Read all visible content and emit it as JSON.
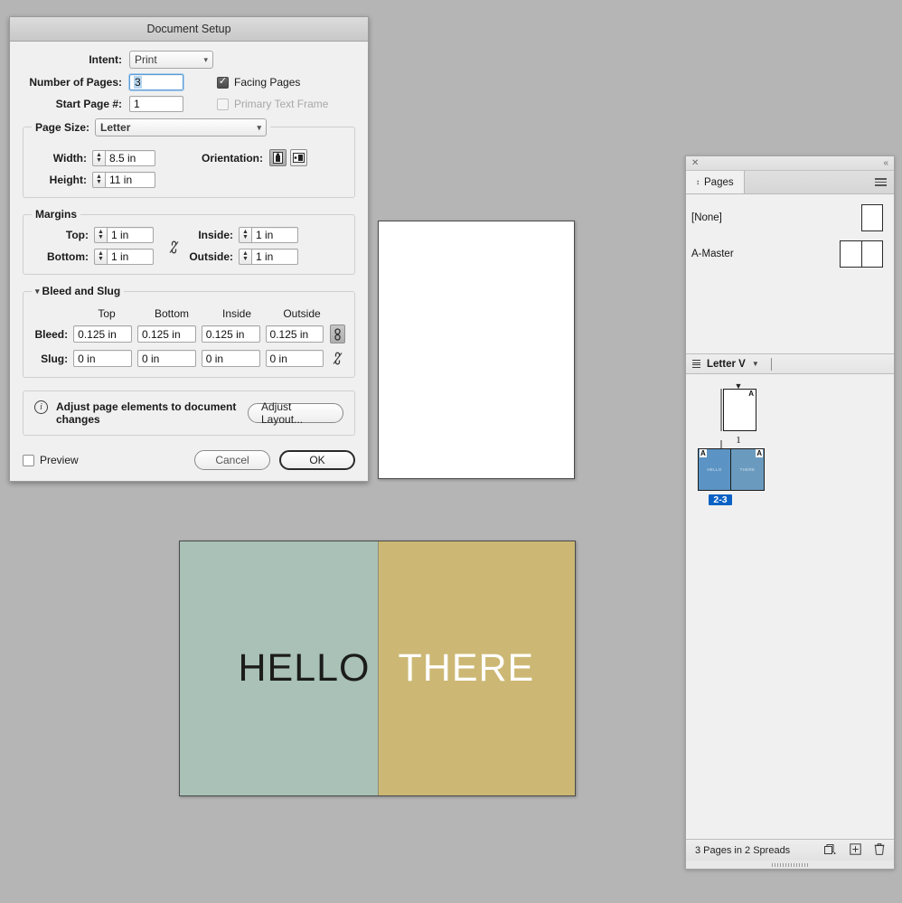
{
  "canvas": {
    "blank_page": {
      "name": "page-1"
    },
    "spread": {
      "left_text": "HELLO",
      "right_text": "THERE",
      "left_color": "#a9c1b6",
      "right_color": "#ccb874",
      "left_text_color": "#1c1c1c",
      "right_text_color": "#ffffff"
    }
  },
  "dialog": {
    "title": "Document Setup",
    "intent": {
      "label": "Intent:",
      "value": "Print"
    },
    "number_of_pages": {
      "label": "Number of Pages:",
      "value": "3"
    },
    "start_page": {
      "label": "Start Page #:",
      "value": "1"
    },
    "facing_pages": {
      "label": "Facing Pages",
      "checked": true
    },
    "primary_text_frame": {
      "label": "Primary Text Frame",
      "checked": false,
      "disabled": true
    },
    "page_size": {
      "label": "Page Size:",
      "value": "Letter"
    },
    "width": {
      "label": "Width:",
      "value": "8.5 in"
    },
    "height": {
      "label": "Height:",
      "value": "11 in"
    },
    "orientation": {
      "label": "Orientation:",
      "selected": "portrait"
    },
    "margins": {
      "title": "Margins",
      "top": {
        "label": "Top:",
        "value": "1 in"
      },
      "bottom": {
        "label": "Bottom:",
        "value": "1 in"
      },
      "inside": {
        "label": "Inside:",
        "value": "1 in"
      },
      "outside": {
        "label": "Outside:",
        "value": "1 in"
      },
      "link_state": "unlinked"
    },
    "bleed_slug": {
      "title": "Bleed and Slug",
      "columns": [
        "Top",
        "Bottom",
        "Inside",
        "Outside"
      ],
      "bleed": {
        "label": "Bleed:",
        "values": [
          "0.125 in",
          "0.125 in",
          "0.125 in",
          "0.125 in"
        ],
        "link_state": "linked"
      },
      "slug": {
        "label": "Slug:",
        "values": [
          "0 in",
          "0 in",
          "0 in",
          "0 in"
        ],
        "link_state": "unlinked"
      }
    },
    "adjust_layout": {
      "message": "Adjust page elements to document changes",
      "button_label": "Adjust Layout..."
    },
    "preview": {
      "label": "Preview",
      "checked": false
    },
    "cancel_label": "Cancel",
    "ok_label": "OK"
  },
  "pages_panel": {
    "tab_label": "Pages",
    "masters": [
      {
        "name": "[None]",
        "type": "single"
      },
      {
        "name": "A-Master",
        "type": "spread"
      }
    ],
    "size_menu": {
      "value": "Letter V"
    },
    "pages": [
      {
        "label": "1",
        "selected": false,
        "master": "A",
        "type": "single"
      },
      {
        "label": "2-3",
        "selected": true,
        "master_left": "A",
        "master_right": "A",
        "type": "spread",
        "left_text": "HELLO",
        "right_text": "THERE"
      }
    ],
    "status": "3 Pages in 2 Spreads"
  }
}
